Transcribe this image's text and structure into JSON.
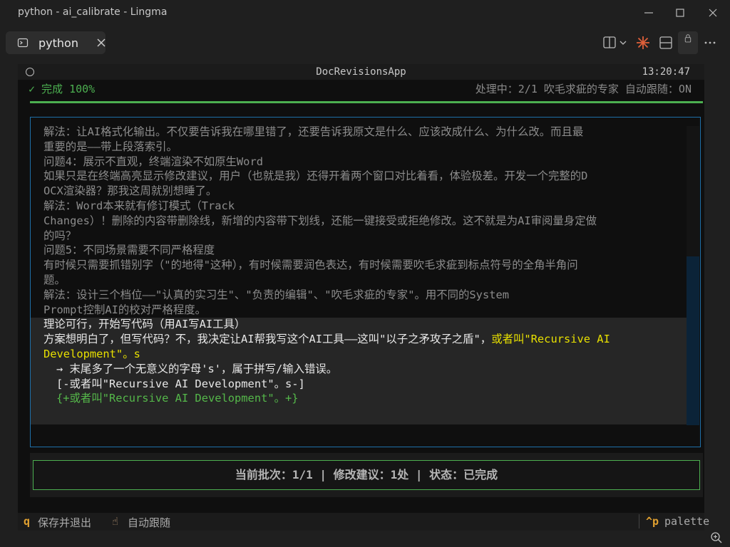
{
  "window": {
    "title": "python - ai_calibrate - Lingma"
  },
  "tab": {
    "label": "python"
  },
  "app": {
    "title": "DocRevisionsApp",
    "clock": "13:20:47"
  },
  "status": {
    "done": "✓ 完成 100%",
    "right": "处理中：2/1 吹毛求疵的专家 自动跟随：ON"
  },
  "content": {
    "lines": [
      "解法：让AI格式化输出。不仅要告诉我在哪里错了，还要告诉我原文是什么、应该改成什么、为什么改。而且最",
      "重要的是——带上段落索引。",
      "问题4：展示不直观，终端渲染不如原生Word",
      "如果只是在终端高亮显示修改建议，用户（也就是我）还得开着两个窗口对比着看，体验极差。开发一个完整的D",
      "OCX渲染器？那我这周就别想睡了。",
      "解法：Word本来就有修订模式（Track",
      "Changes）！删除的内容带删除线，新增的内容带下划线，还能一键接受或拒绝修改。这不就是为AI审阅量身定做",
      "的吗？",
      "问题5：不同场景需要不同严格程度",
      "有时候只需要抓错别字（\"的地得\"这种），有时候需要润色表达，有时候需要吹毛求疵到标点符号的全角半角问",
      "题。",
      "解法：设计三个档位——\"认真的实习生\"、\"负责的编辑\"、\"吹毛求疵的专家\"。用不同的System",
      "Prompt控制AI的校对严格程度。"
    ],
    "heading": "理论可行，开始写代码（用AI写AI工具）",
    "para_start": "方案想明白了，但写代码？不，我决定让AI帮我写这个AI工具——这叫\"以子之矛攻子之盾\"，",
    "para_highlight": "或者叫\"Recursive AI",
    "para_highlight2": "Development\"。s",
    "note": "→ 末尾多了一个无意义的字母's'，属于拼写/输入错误。",
    "deleted": "[-或者叫\"Recursive AI Development\"。s-]",
    "added": "{+或者叫\"Recursive AI Development\"。+}"
  },
  "summary": "当前批次：1/1 | 修改建议：1处 | 状态：已完成",
  "footer": {
    "key_quit": "q",
    "label_quit": "保存并退出",
    "key_follow": "☝",
    "label_follow": "自动跟随",
    "key_palette": "^p",
    "label_palette": "palette"
  },
  "colors": {
    "success": "#4caf50",
    "accent_border": "#1e6fa8",
    "highlight": "#e8e000",
    "shortcut": "#e0a030"
  }
}
